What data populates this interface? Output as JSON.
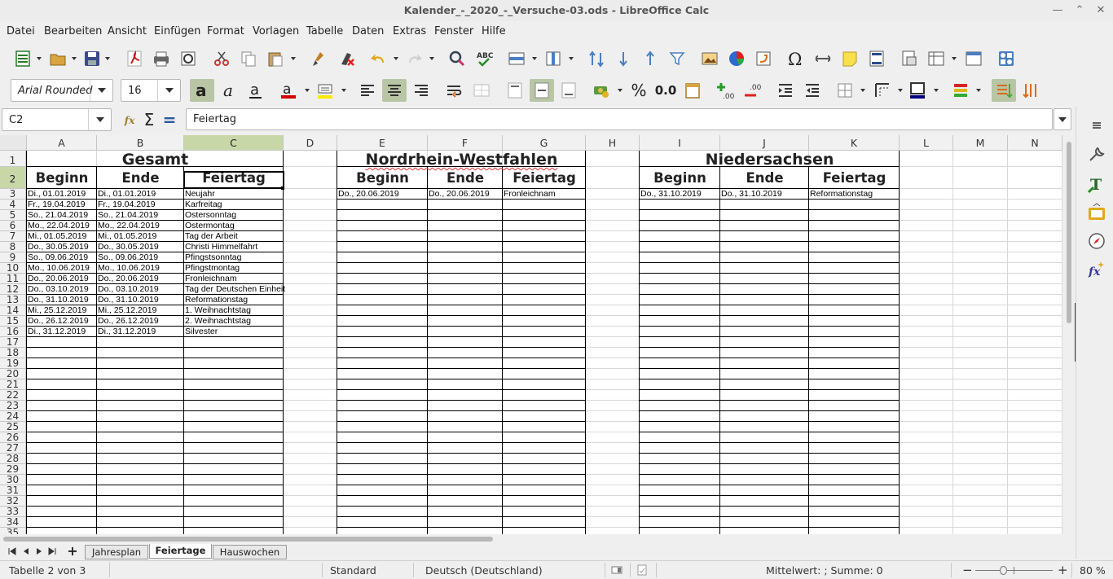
{
  "window": {
    "title": "Kalender_-_2020_-_Versuche-03.ods - LibreOffice Calc"
  },
  "menu": [
    "Datei",
    "Bearbeiten",
    "Ansicht",
    "Einfügen",
    "Format",
    "Vorlagen",
    "Tabelle",
    "Daten",
    "Extras",
    "Fenster",
    "Hilfe"
  ],
  "format_bar": {
    "font_name": "Arial Rounded",
    "font_size": "16",
    "percent": "%",
    "decimal": "0.0"
  },
  "formula_bar": {
    "cell_ref": "C2",
    "content": "Feiertag",
    "fx": "fx",
    "sigma": "Σ",
    "equals": "="
  },
  "columns": [
    "A",
    "B",
    "C",
    "D",
    "E",
    "F",
    "G",
    "H",
    "I",
    "J",
    "K",
    "L",
    "M",
    "N"
  ],
  "selected_column": "C",
  "selected_row": "2",
  "rows": [
    "1",
    "2",
    "3",
    "4",
    "5",
    "6",
    "7",
    "8",
    "9",
    "10",
    "11",
    "12",
    "13",
    "14",
    "15",
    "16",
    "17",
    "18",
    "19",
    "20",
    "21",
    "22",
    "23",
    "24",
    "25",
    "26",
    "27",
    "28",
    "29",
    "30",
    "31",
    "32",
    "33",
    "34",
    "35"
  ],
  "sections": {
    "gesamt": {
      "title": "Gesamt",
      "headers": [
        "Beginn",
        "Ende",
        "Feiertag"
      ]
    },
    "nrw": {
      "title": "Nordrhein-Westfahlen",
      "headers": [
        "Beginn",
        "Ende",
        "Feiertag"
      ]
    },
    "nds": {
      "title": "Niedersachsen",
      "headers": [
        "Beginn",
        "Ende",
        "Feiertag"
      ]
    }
  },
  "gesamt_rows": [
    [
      "Di., 01.01.2019",
      "Di., 01.01.2019",
      "Neujahr"
    ],
    [
      "Fr., 19.04.2019",
      "Fr., 19.04.2019",
      "Karfreitag"
    ],
    [
      "So., 21.04.2019",
      "So., 21.04.2019",
      "Ostersonntag"
    ],
    [
      "Mo., 22.04.2019",
      "Mo., 22.04.2019",
      "Ostermontag"
    ],
    [
      "Mi., 01.05.2019",
      "Mi., 01.05.2019",
      "Tag der Arbeit"
    ],
    [
      "Do., 30.05.2019",
      "Do., 30.05.2019",
      "Christi Himmelfahrt"
    ],
    [
      "So., 09.06.2019",
      "So., 09.06.2019",
      "Pfingstsonntag"
    ],
    [
      "Mo., 10.06.2019",
      "Mo., 10.06.2019",
      "Pfingstmontag"
    ],
    [
      "Do., 20.06.2019",
      "Do., 20.06.2019",
      "Fronleichnam"
    ],
    [
      "Do., 03.10.2019",
      "Do., 03.10.2019",
      "Tag der Deutschen Einheit"
    ],
    [
      "Do., 31.10.2019",
      "Do., 31.10.2019",
      "Reformationstag"
    ],
    [
      "Mi., 25.12.2019",
      "Mi., 25.12.2019",
      "1. Weihnachtstag"
    ],
    [
      "Do., 26.12.2019",
      "Do., 26.12.2019",
      "2. Weihnachtstag"
    ],
    [
      "Di., 31.12.2019",
      "Di., 31.12.2019",
      "Silvester"
    ]
  ],
  "nrw_rows": [
    [
      "Do., 20.06.2019",
      "Do., 20.06.2019",
      "Fronleichnam"
    ]
  ],
  "nds_rows": [
    [
      "Do., 31.10.2019",
      "Do., 31.10.2019",
      "Reformationstag"
    ]
  ],
  "sheet_tabs": [
    "Jahresplan",
    "Feiertage",
    "Hauswochen"
  ],
  "active_tab": "Feiertage",
  "add_tab": "+",
  "status": {
    "sheet": "Tabelle 2 von 3",
    "style": "Standard",
    "language": "Deutsch (Deutschland)",
    "summary": "Mittelwert: ; Summe: 0",
    "zoom": "80 %",
    "zoom_minus": "−",
    "zoom_plus": "+"
  }
}
